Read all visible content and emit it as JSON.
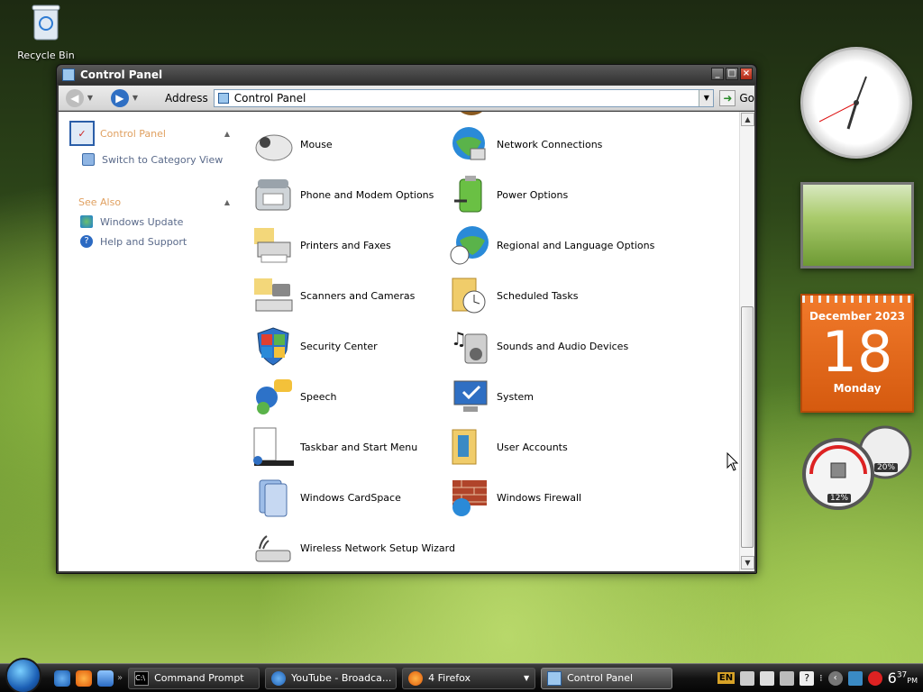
{
  "desktop": {
    "recycle_bin_label": "Recycle Bin"
  },
  "window": {
    "title": "Control Panel",
    "address_label": "Address",
    "address_value": "Control Panel",
    "go_label": "Go"
  },
  "task_pane": {
    "header": "Control Panel",
    "switch_link": "Switch to Category View",
    "see_also_header": "See Also",
    "links": [
      "Windows Update",
      "Help and Support"
    ]
  },
  "items": [
    {
      "label": "Mouse",
      "icon": "mouse-icon"
    },
    {
      "label": "Network Connections",
      "icon": "network-icon"
    },
    {
      "label": "Phone and Modem Options",
      "icon": "phone-icon"
    },
    {
      "label": "Power Options",
      "icon": "battery-icon"
    },
    {
      "label": "Printers and Faxes",
      "icon": "printer-icon"
    },
    {
      "label": "Regional and Language Options",
      "icon": "globe-icon"
    },
    {
      "label": "Scanners and Cameras",
      "icon": "scanner-icon"
    },
    {
      "label": "Scheduled Tasks",
      "icon": "folder-clock-icon"
    },
    {
      "label": "Security Center",
      "icon": "shield-icon"
    },
    {
      "label": "Sounds and Audio Devices",
      "icon": "speaker-icon"
    },
    {
      "label": "Speech",
      "icon": "speech-icon"
    },
    {
      "label": "System",
      "icon": "monitor-icon"
    },
    {
      "label": "Taskbar and Start Menu",
      "icon": "taskbar-icon"
    },
    {
      "label": "User Accounts",
      "icon": "users-icon"
    },
    {
      "label": "Windows CardSpace",
      "icon": "cardspace-icon"
    },
    {
      "label": "Windows Firewall",
      "icon": "firewall-icon"
    },
    {
      "label": "Wireless Network Setup Wizard",
      "icon": "wireless-icon"
    }
  ],
  "gadgets": {
    "calendar_month": "December 2023",
    "calendar_day": "18",
    "calendar_weekday": "Monday",
    "cpu_percent": "12%",
    "memory_percent": "20%"
  },
  "taskbar": {
    "tasks": [
      {
        "label": "Command Prompt",
        "active": false
      },
      {
        "label": "YouTube - Broadca...",
        "active": false
      },
      {
        "label": "4 Firefox",
        "active": false
      },
      {
        "label": "Control Panel",
        "active": true
      }
    ],
    "language": "EN",
    "time_hour": "6",
    "time_minute": "37",
    "time_ampm": "PM"
  }
}
